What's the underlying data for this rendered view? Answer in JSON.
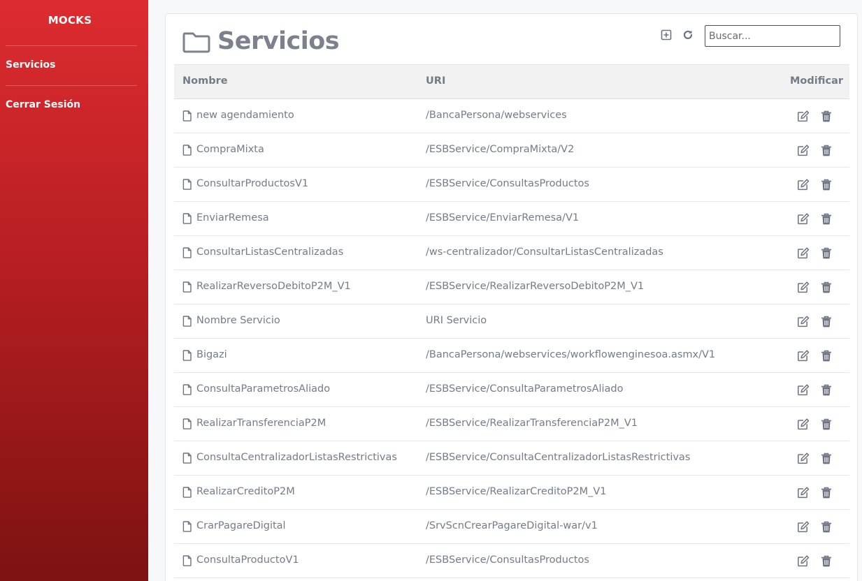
{
  "sidebar": {
    "brand": "MOCKS",
    "items": [
      {
        "label": "Servicios",
        "icon": "none"
      },
      {
        "label": "Cerrar Sesión",
        "icon": "none"
      }
    ],
    "gradient_top": "#dd2c30",
    "gradient_bottom": "#7d1212"
  },
  "header": {
    "title": "Servicios",
    "title_icon": "folder-icon",
    "add_icon": "plus-square-icon",
    "refresh_icon": "refresh-icon"
  },
  "search": {
    "placeholder": "Buscar...",
    "value": ""
  },
  "table": {
    "columns": [
      "Nombre",
      "URI",
      "Modificar"
    ],
    "rows": [
      {
        "name": "new agendamiento",
        "uri": "/BancaPersona/webservices"
      },
      {
        "name": "CompraMixta",
        "uri": "/ESBService/CompraMixta/V2"
      },
      {
        "name": "ConsultarProductosV1",
        "uri": "/ESBService/ConsultasProductos"
      },
      {
        "name": "EnviarRemesa",
        "uri": "/ESBService/EnviarRemesa/V1"
      },
      {
        "name": "ConsultarListasCentralizadas",
        "uri": "/ws-centralizador/ConsultarListasCentralizadas"
      },
      {
        "name": "RealizarReversoDebitoP2M_V1",
        "uri": "/ESBService/RealizarReversoDebitoP2M_V1"
      },
      {
        "name": "Nombre Servicio",
        "uri": "URI Servicio"
      },
      {
        "name": "Bigazi",
        "uri": "/BancaPersona/webservices/workflowenginesoa.asmx/V1"
      },
      {
        "name": "ConsultaParametrosAliado",
        "uri": "/ESBService/ConsultaParametrosAliado"
      },
      {
        "name": "RealizarTransferenciaP2M",
        "uri": "/ESBService/RealizarTransferenciaP2M_V1"
      },
      {
        "name": "ConsultaCentralizadorListasRestrictivas",
        "uri": "/ESBService/ConsultaCentralizadorListasRestrictivas"
      },
      {
        "name": "RealizarCreditoP2M",
        "uri": "/ESBService/RealizarCreditoP2M_V1"
      },
      {
        "name": "CrarPagareDigital",
        "uri": "/SrvScnCrearPagareDigital-war/v1"
      },
      {
        "name": "ConsultaProductoV1",
        "uri": "/ESBService/ConsultasProductos"
      }
    ],
    "row_icons": {
      "file": "file-icon",
      "edit": "edit-icon",
      "delete": "trash-icon"
    }
  },
  "colors": {
    "text": "#737c88",
    "title": "#7b828e",
    "header_bg": "#f2f2f2"
  }
}
